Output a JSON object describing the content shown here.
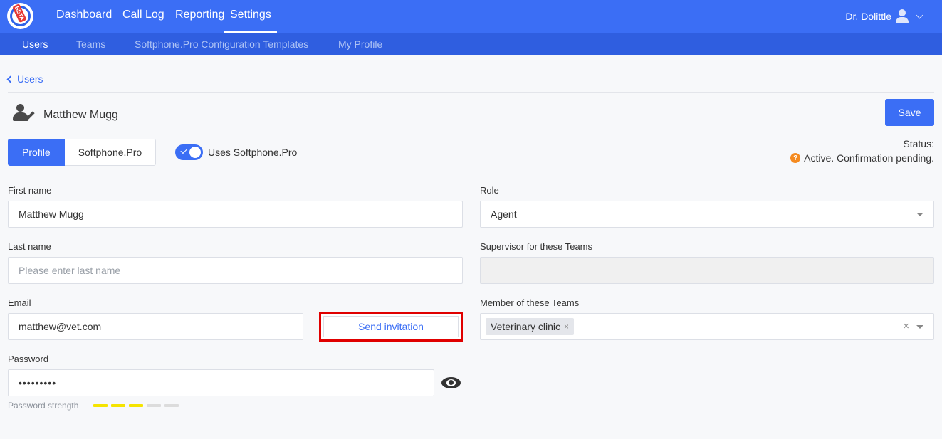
{
  "logo": {
    "badge": "BETA"
  },
  "nav": {
    "items": [
      {
        "label": "Dashboard",
        "active": false
      },
      {
        "label": "Call Log",
        "active": false
      },
      {
        "label": "Reporting",
        "active": false
      },
      {
        "label": "Settings",
        "active": true
      }
    ],
    "user_name": "Dr. Dolittle"
  },
  "subnav": {
    "items": [
      {
        "label": "Users",
        "active": true
      },
      {
        "label": "Teams",
        "active": false
      },
      {
        "label": "Softphone.Pro Configuration Templates",
        "active": false
      },
      {
        "label": "My Profile",
        "active": false
      }
    ]
  },
  "breadcrumb": {
    "back_label": "Users"
  },
  "page": {
    "title": "Matthew Mugg",
    "save_label": "Save"
  },
  "tabs": [
    {
      "label": "Profile",
      "active": true
    },
    {
      "label": "Softphone.Pro",
      "active": false
    }
  ],
  "toggle": {
    "label": "Uses Softphone.Pro",
    "on": true
  },
  "status": {
    "label": "Status:",
    "value": "Active. Confirmation pending.",
    "icon": "question-circle-icon",
    "color": "#f58a1f"
  },
  "form": {
    "first_name": {
      "label": "First name",
      "value": "Matthew Mugg"
    },
    "last_name": {
      "label": "Last name",
      "value": "",
      "placeholder": "Please enter last name"
    },
    "email": {
      "label": "Email",
      "value": "matthew@vet.com"
    },
    "send_invitation_label": "Send invitation",
    "password": {
      "label": "Password",
      "value": "password1"
    },
    "password_strength": {
      "label": "Password strength",
      "level": 3,
      "max": 5,
      "active_color": "#f5e400",
      "inactive_color": "#dcdcdc"
    },
    "role": {
      "label": "Role",
      "value": "Agent"
    },
    "supervisor_teams": {
      "label": "Supervisor for these Teams",
      "value": ""
    },
    "member_teams": {
      "label": "Member of these Teams",
      "tags": [
        "Veterinary clinic"
      ]
    }
  },
  "colors": {
    "primary": "#3b6ef5",
    "highlight_border": "#e00000"
  }
}
